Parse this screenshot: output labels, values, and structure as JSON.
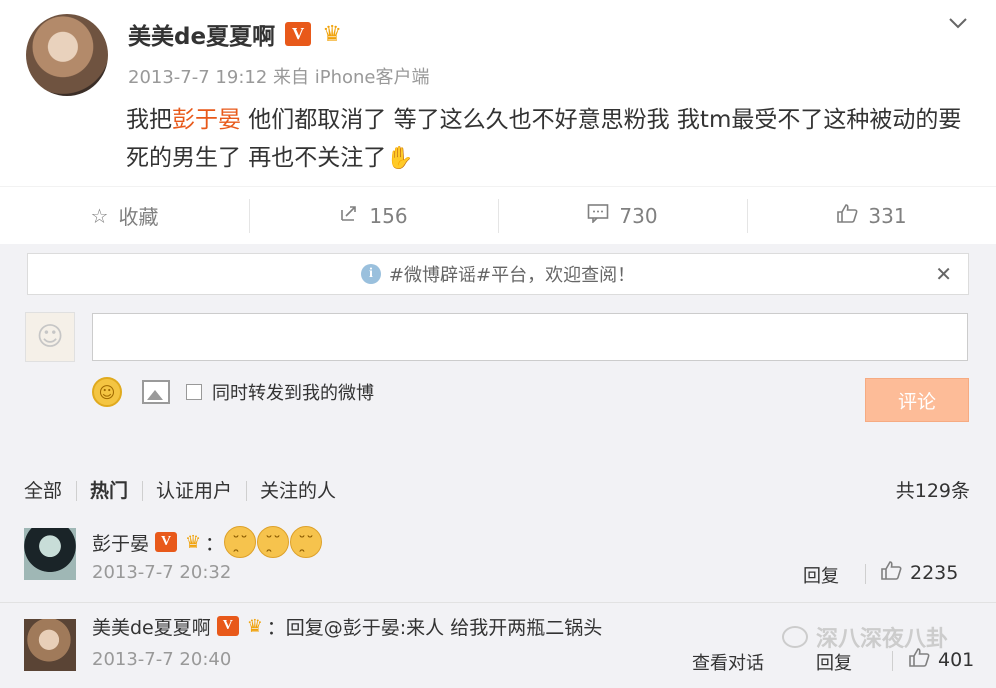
{
  "post": {
    "author": "美美de夏夏啊",
    "verified_badge": "V",
    "crown_icon": "crown-icon",
    "meta": "2013-7-7 19:12 来自 iPhone客户端",
    "content_before": "我把",
    "content_highlight": "彭于晏",
    "content_after": " 他们都取消了 等了这么久也不好意思粉我 我tm最受不了这种被动的要死的男生了 再也不关注了",
    "emoji": "✋"
  },
  "actions": {
    "favorite": "收藏",
    "repost": "156",
    "comment": "730",
    "like": "331"
  },
  "notice": {
    "text": "#微博辟谣#平台，欢迎查阅！",
    "close": "✕"
  },
  "compose": {
    "input_value": "",
    "checkbox_label": "同时转发到我的微博",
    "submit": "评论"
  },
  "filters": {
    "items": [
      "全部",
      "热门",
      "认证用户",
      "关注的人"
    ],
    "active": "热门",
    "total": "共129条"
  },
  "comments": [
    {
      "name": "彭于晏",
      "separator": "：",
      "text": "",
      "emoji_count": 3,
      "time": "2013-7-7 20:32",
      "reply": "回复",
      "likes": "2235"
    },
    {
      "name": "美美de夏夏啊",
      "separator": "：",
      "text": "回复@彭于晏:来人 给我开两瓶二锅头",
      "time": "2013-7-7 20:40",
      "view_conversation": "查看对话",
      "reply": "回复",
      "likes": "401"
    }
  ],
  "watermark": "深八深夜八卦",
  "colors": {
    "accent": "#e8591a",
    "submit_bg": "#fdbc98",
    "comment_bg": "#f2f2f5"
  }
}
